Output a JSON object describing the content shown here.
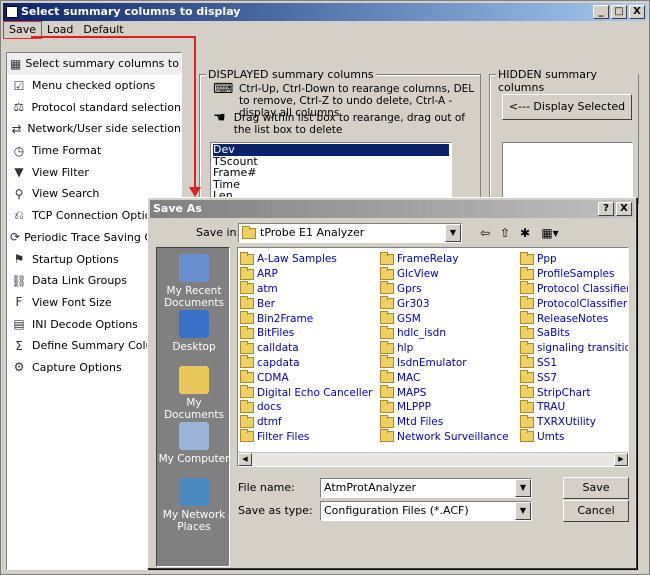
{
  "window": {
    "title": "Select summary columns to display",
    "controls": [
      "_",
      "□",
      "X"
    ]
  },
  "menu": {
    "save": "Save",
    "load": "Load",
    "default": "Default"
  },
  "nav_items": [
    {
      "label": "Select summary columns to display",
      "icon": "columns-grid-icon",
      "glyph": "▦"
    },
    {
      "label": "Menu checked options",
      "icon": "checked-menu-icon",
      "glyph": "☑"
    },
    {
      "label": "Protocol standard selection",
      "icon": "protocol-std-icon",
      "glyph": "⚖"
    },
    {
      "label": "Network/User side selection",
      "icon": "network-user-icon",
      "glyph": "⇄"
    },
    {
      "label": "Time Format",
      "icon": "clock-icon",
      "glyph": "◷"
    },
    {
      "label": "View Filter",
      "icon": "filter-icon",
      "glyph": "▼"
    },
    {
      "label": "View Search",
      "icon": "binoculars-icon",
      "glyph": "⚲"
    },
    {
      "label": "TCP Connection Options",
      "icon": "tcp-icon",
      "glyph": "⎌"
    },
    {
      "label": "Periodic Trace Saving Options",
      "icon": "periodic-save-icon",
      "glyph": "⟳"
    },
    {
      "label": "Startup Options",
      "icon": "startup-icon",
      "glyph": "⚑"
    },
    {
      "label": "Data Link Groups",
      "icon": "link-groups-icon",
      "glyph": "⛓"
    },
    {
      "label": "View Font Size",
      "icon": "font-size-icon",
      "glyph": "F"
    },
    {
      "label": "INI Decode Options",
      "icon": "ini-decode-icon",
      "glyph": "▤"
    },
    {
      "label": "Define Summary Columns",
      "icon": "sigma-icon",
      "glyph": "Σ"
    },
    {
      "label": "Capture Options",
      "icon": "capture-icon",
      "glyph": "⚙"
    }
  ],
  "displayed": {
    "title": "DISPLAYED summary columns",
    "hint1": "Ctrl-Up, Ctrl-Down to rearange columns, DEL to remove, Ctrl-Z to undo delete, Ctrl-A - display all columns",
    "hint2": "Drag within list box to rearange, drag out of the list box to delete",
    "items": [
      "Dev",
      "TScount",
      "Frame#",
      "Time",
      "Len"
    ]
  },
  "hidden": {
    "title": "HIDDEN summary columns",
    "button": "<--- Display Selected"
  },
  "dialog": {
    "title": "Save As",
    "controls": [
      "?",
      "X"
    ],
    "save_in_label": "Save in:",
    "save_in_value": "tProbe E1 Analyzer",
    "places": [
      "My Recent Documents",
      "Desktop",
      "My Documents",
      "My Computer",
      "My Network Places"
    ],
    "columns": [
      [
        "A-Law Samples",
        "ARP",
        "atm",
        "Ber",
        "Bin2Frame",
        "BitFiles",
        "calldata",
        "capdata",
        "CDMA",
        "Digital Echo Canceller",
        "docs",
        "dtmf",
        "Filter Files"
      ],
      [
        "FrameRelay",
        "GlcView",
        "Gprs",
        "Gr303",
        "GSM",
        "hdlc_isdn",
        "hlp",
        "IsdnEmulator",
        "MAC",
        "MAPS",
        "MLPPP",
        "Mtd Files",
        "Network Surveillance"
      ],
      [
        "Ppp",
        "ProfileSamples",
        "Protocol Classifier Raw",
        "ProtocolClassifier",
        "ReleaseNotes",
        "SaBits",
        "signaling transitions",
        "SS1",
        "SS7",
        "StripChart",
        "TRAU",
        "TXRXUtility",
        "Umts"
      ]
    ],
    "file_name_label": "File name:",
    "file_name_value": "AtmProtAnalyzer",
    "save_type_label": "Save as type:",
    "save_type_value": "Configuration Files (*.ACF)",
    "save_button": "Save",
    "cancel_button": "Cancel"
  },
  "colors": {
    "annotation": "#e02020",
    "titlebar": "#0a246a",
    "link": "#0000c0"
  }
}
